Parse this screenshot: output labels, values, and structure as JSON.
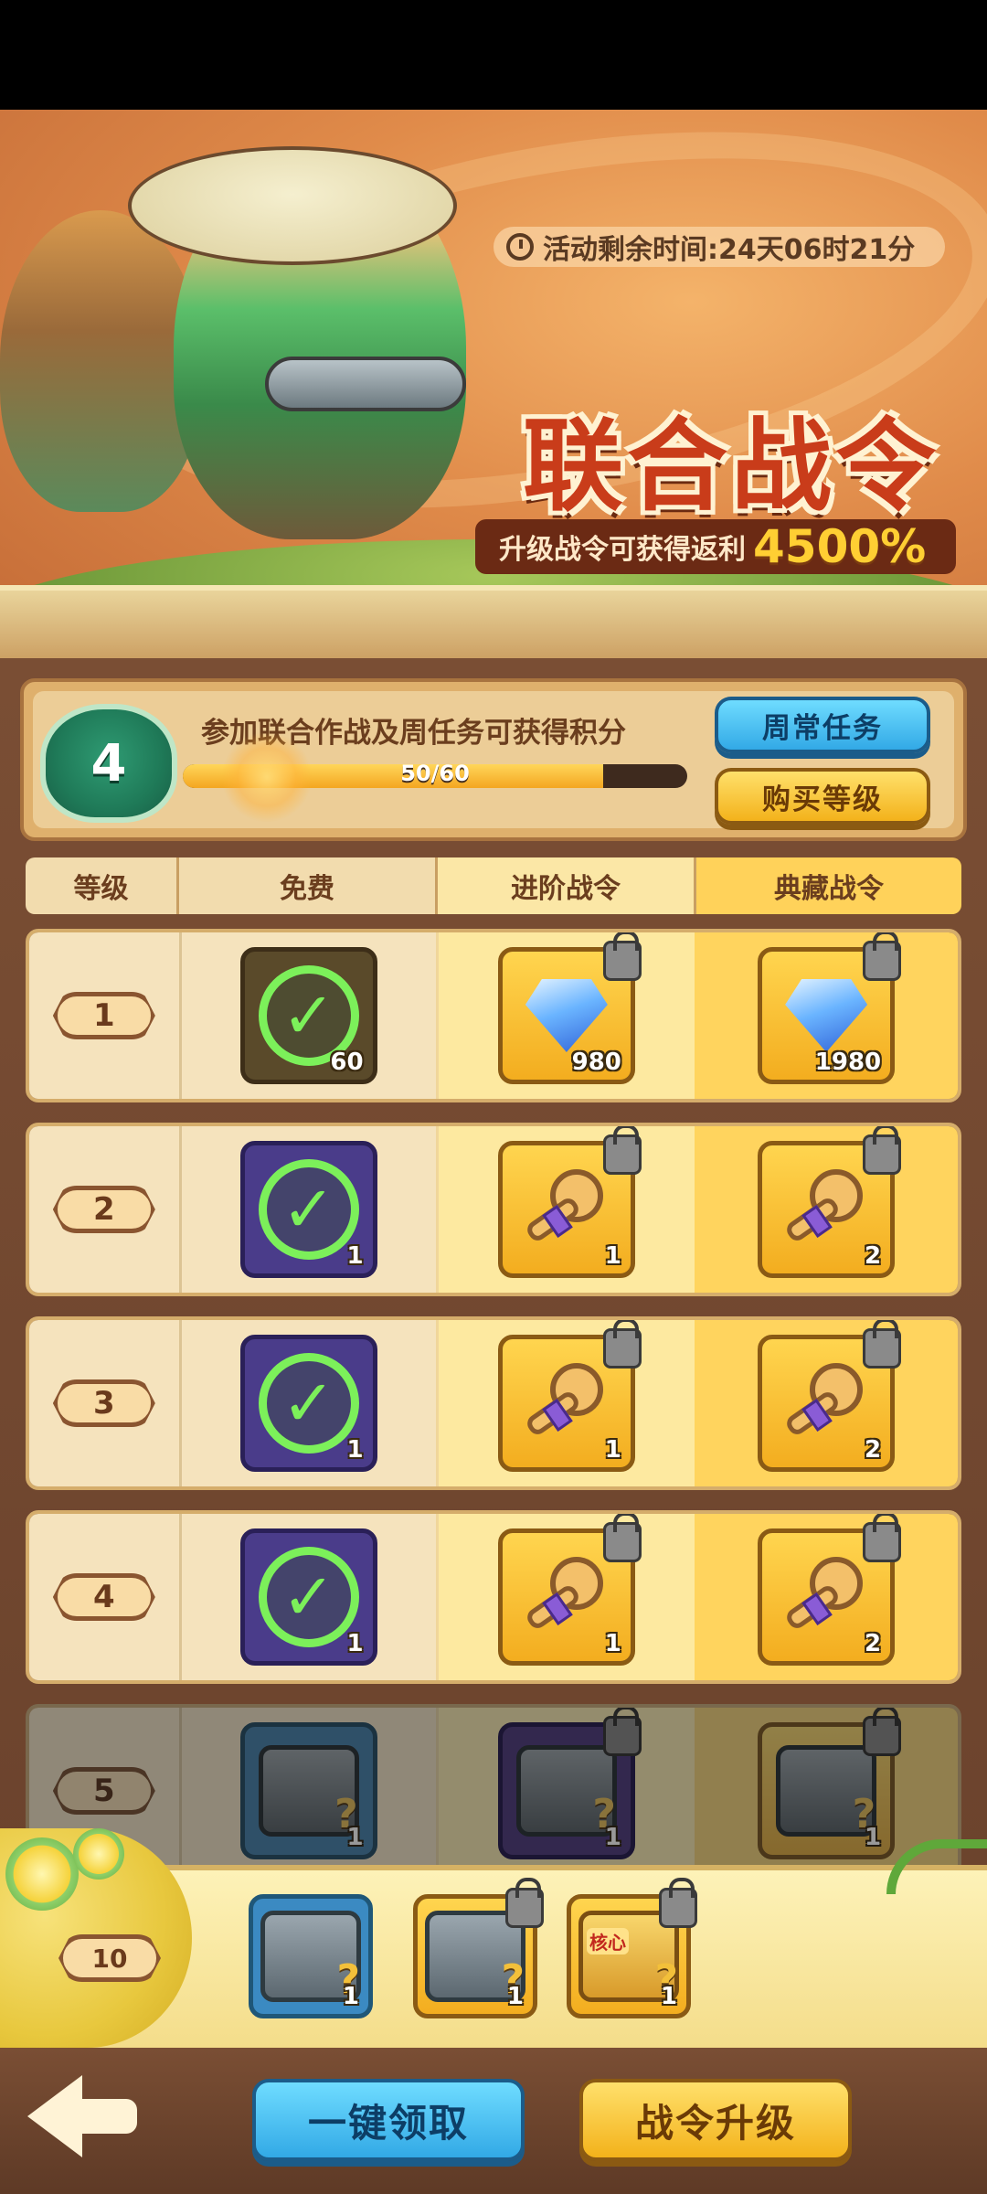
{
  "event": {
    "title": "联合战令",
    "timer_label": "活动剩余时间:24天06时21分",
    "rebate_label": "升级战令可获得返利",
    "rebate_value": "4500%"
  },
  "progress": {
    "level": "4",
    "task_text": "参加联合作战及周任务可获得积分",
    "current_text": "50/60",
    "fraction": 0.8333
  },
  "buttons": {
    "daily_tasks": "周常任务",
    "buy_levels": "购买等级",
    "claim_all": "一键领取",
    "pass_upgrade": "战令升级"
  },
  "columns": {
    "level": "等级",
    "free": "免费",
    "advanced": "进阶战令",
    "collector": "典藏战令"
  },
  "rows": [
    {
      "level": "1",
      "free": {
        "claimed": true,
        "qty": "60"
      },
      "advanced": {
        "icon": "diamond-icon",
        "qty": "980",
        "locked": true
      },
      "collector": {
        "icon": "diamond-icon",
        "qty": "1980",
        "locked": true
      }
    },
    {
      "level": "2",
      "free": {
        "claimed": true,
        "qty": "1"
      },
      "advanced": {
        "icon": "key-icon",
        "qty": "1",
        "locked": true
      },
      "collector": {
        "icon": "key-icon",
        "qty": "2",
        "locked": true
      }
    },
    {
      "level": "3",
      "free": {
        "claimed": true,
        "qty": "1"
      },
      "advanced": {
        "icon": "key-icon",
        "qty": "1",
        "locked": true
      },
      "collector": {
        "icon": "key-icon",
        "qty": "2",
        "locked": true
      }
    },
    {
      "level": "4",
      "free": {
        "claimed": true,
        "qty": "1"
      },
      "advanced": {
        "icon": "key-icon",
        "qty": "1",
        "locked": true
      },
      "collector": {
        "icon": "key-icon",
        "qty": "2",
        "locked": true
      }
    },
    {
      "level": "5",
      "free": {
        "icon": "chest-icon",
        "qty": "1"
      },
      "advanced": {
        "icon": "chest-icon",
        "qty": "1",
        "locked": true
      },
      "collector": {
        "icon": "chest-icon",
        "qty": "1",
        "locked": true
      }
    }
  ],
  "bonus": {
    "level": "10",
    "items": [
      {
        "icon": "chest-icon",
        "qty": "1",
        "locked": false
      },
      {
        "icon": "chest-icon",
        "qty": "1",
        "locked": true
      },
      {
        "icon": "chest-icon",
        "qty": "1",
        "locked": true,
        "tag": "核心"
      }
    ]
  }
}
